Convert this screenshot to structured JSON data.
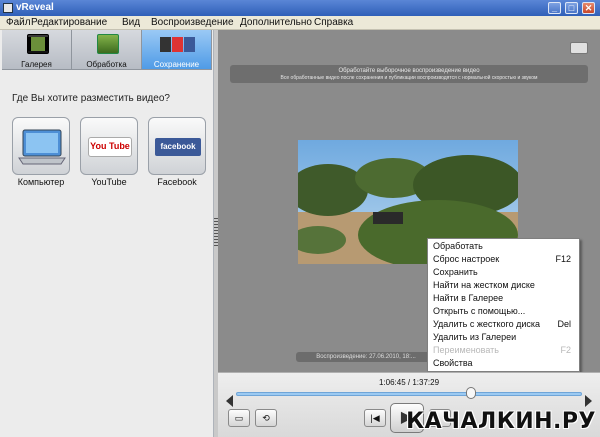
{
  "window": {
    "title": "vReveal",
    "min": "_",
    "max": "□",
    "close": "✕"
  },
  "menu": [
    "Файл",
    "Редактирование",
    "Вид",
    "Воспроизведение",
    "Дополнительно",
    "Справка"
  ],
  "tabs": [
    {
      "label": "Галерея",
      "icon": "gallery-icon",
      "active": false
    },
    {
      "label": "Обработка",
      "icon": "enhance-icon",
      "active": false
    },
    {
      "label": "Сохранение",
      "icon": "save-icon",
      "active": true
    }
  ],
  "left": {
    "question": "Где Вы хотите разместить видео?",
    "destinations": [
      {
        "label": "Компьютер",
        "icon": "computer-icon"
      },
      {
        "label": "YouTube",
        "icon": "youtube-icon",
        "logo": "You Tube"
      },
      {
        "label": "Facebook",
        "icon": "facebook-icon",
        "logo": "facebook"
      }
    ]
  },
  "viewer": {
    "notice_line1": "Обработайте выборочное воспроизведение видео",
    "notice_line2": "Все обработанные видео после сохранения и публикации воспроизводятся с нормальной скоростью и звуком",
    "caption": "Воспроизведение: 27.06.2010, 18:...",
    "accent": "#4f9be6"
  },
  "context_menu": [
    {
      "label": "Обработать",
      "key": "",
      "disabled": false
    },
    {
      "label": "Сброс настроек",
      "key": "F12",
      "disabled": false
    },
    {
      "label": "Сохранить",
      "key": "",
      "disabled": false
    },
    {
      "label": "Найти на жестком диске",
      "key": "",
      "disabled": false
    },
    {
      "label": "Найти в Галерее",
      "key": "",
      "disabled": false
    },
    {
      "label": "Открыть с помощью...",
      "key": "",
      "disabled": false
    },
    {
      "label": "Удалить с жесткого диска",
      "key": "Del",
      "disabled": false
    },
    {
      "label": "Удалить из Галереи",
      "key": "",
      "disabled": false
    },
    {
      "label": "Переименовать",
      "key": "F2",
      "disabled": true
    },
    {
      "label": "Свойства",
      "key": "",
      "disabled": false
    }
  ],
  "playback": {
    "timecode": "1:06:45 / 1:37:29",
    "progress": 0.68,
    "play_symbol": "▶",
    "prev_symbol": "|◀",
    "mode_symbol": "▭",
    "loop_symbol": "⟲"
  },
  "watermark": "КАЧАЛКИН.РУ"
}
